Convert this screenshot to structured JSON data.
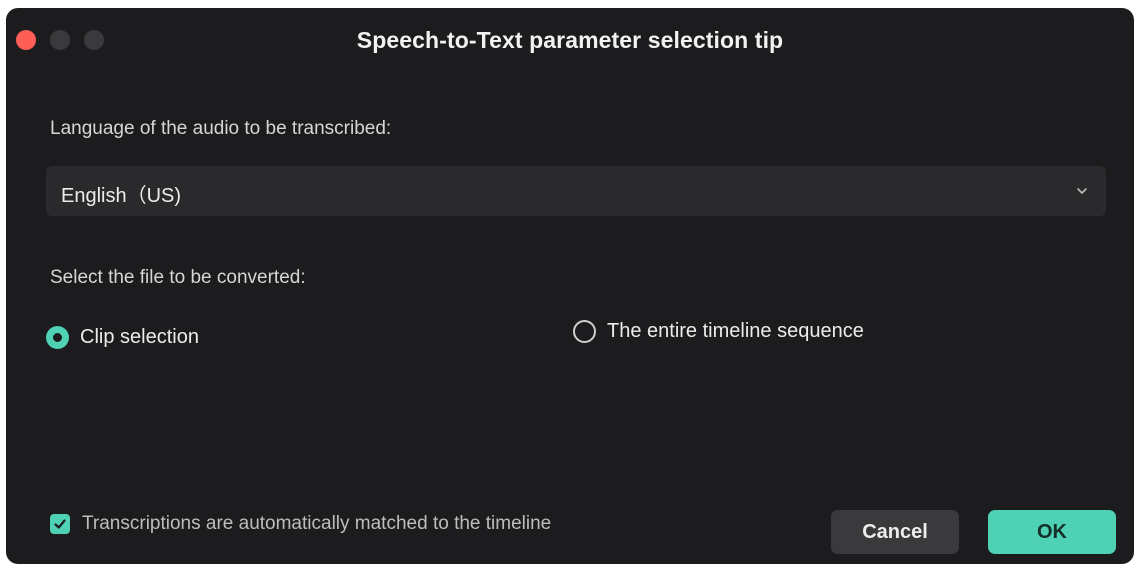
{
  "window": {
    "title": "Speech-to-Text parameter selection tip",
    "traffic_lights": [
      {
        "name": "close",
        "color": "#ff5f57"
      },
      {
        "name": "minimize",
        "color": "#3a3a3c"
      },
      {
        "name": "maximize",
        "color": "#3a3a3c"
      }
    ]
  },
  "language": {
    "label": "Language of the audio to be transcribed:",
    "selected": "English（US)",
    "icon": "chevron-down-icon"
  },
  "file": {
    "label": "Select the file to be converted:",
    "options": [
      {
        "label": "Clip selection",
        "checked": true
      },
      {
        "label": "The entire timeline sequence",
        "checked": false
      }
    ]
  },
  "match_timeline": {
    "label": "Transcriptions are automatically matched to the timeline",
    "checked": true
  },
  "buttons": {
    "cancel": "Cancel",
    "ok": "OK"
  },
  "colors": {
    "accent": "#4fd1b6",
    "background": "#1c1c1e"
  }
}
